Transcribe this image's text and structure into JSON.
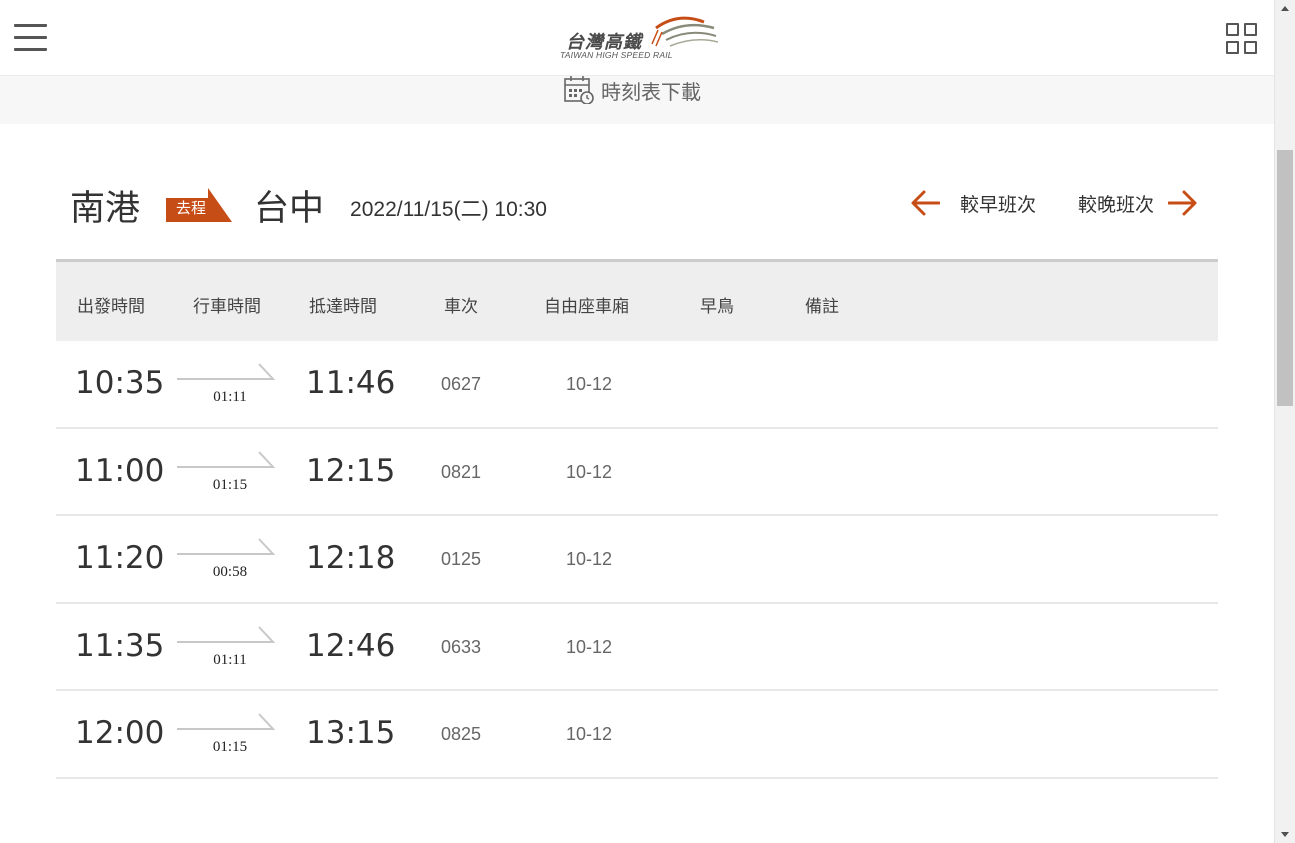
{
  "header": {
    "logo_cn": "台灣高鐵",
    "logo_en": "TAIWAN HIGH SPEED RAIL",
    "menu_icon": "hamburger-menu-icon",
    "apps_icon": "grid-apps-icon"
  },
  "download": {
    "label": "時刻表下載",
    "icon": "calendar-clock-icon"
  },
  "route": {
    "origin": "南港",
    "direction": "去程",
    "destination": "台中",
    "datetime": "2022/11/15(二) 10:30"
  },
  "nav": {
    "earlier": "較早班次",
    "later": "較晚班次"
  },
  "table": {
    "headers": [
      "出發時間",
      "行車時間",
      "抵達時間",
      "車次",
      "自由座車廂",
      "早鳥",
      "備註"
    ],
    "rows": [
      {
        "dep": "10:35",
        "dur": "01:11",
        "arr": "11:46",
        "train": "0627",
        "cars": "10-12"
      },
      {
        "dep": "11:00",
        "dur": "01:15",
        "arr": "12:15",
        "train": "0821",
        "cars": "10-12"
      },
      {
        "dep": "11:20",
        "dur": "00:58",
        "arr": "12:18",
        "train": "0125",
        "cars": "10-12"
      },
      {
        "dep": "11:35",
        "dur": "01:11",
        "arr": "12:46",
        "train": "0633",
        "cars": "10-12"
      },
      {
        "dep": "12:00",
        "dur": "01:15",
        "arr": "13:15",
        "train": "0825",
        "cars": "10-12"
      }
    ]
  },
  "colors": {
    "accent": "#c74d17",
    "header_bg": "#eeeeee",
    "strip_bg": "#f7f7f7"
  }
}
